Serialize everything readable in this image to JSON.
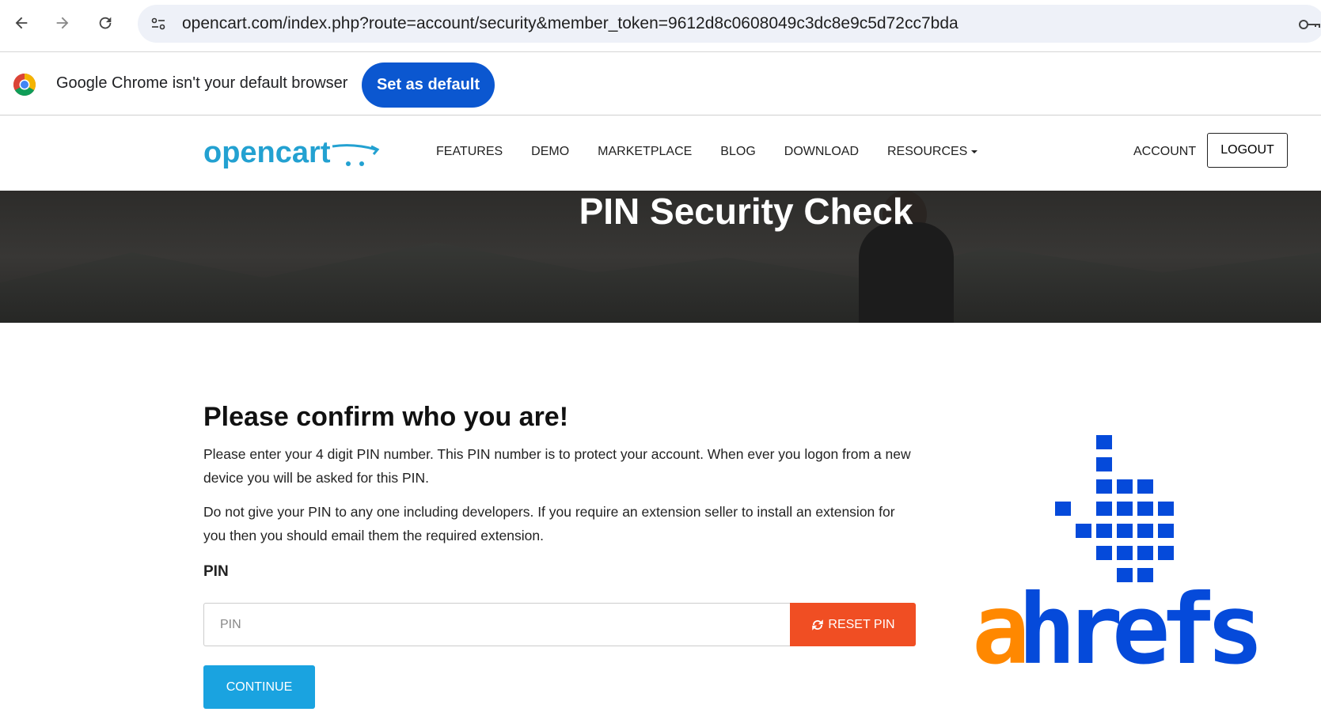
{
  "browser": {
    "url": "opencart.com/index.php?route=account/security&member_token=9612d8c0608049c3dc8e9c5d72cc7bda"
  },
  "infobar": {
    "message": "Google Chrome isn't your default browser",
    "button": "Set as default"
  },
  "header": {
    "logo_text": "opencart",
    "nav": [
      "FEATURES",
      "DEMO",
      "MARKETPLACE",
      "BLOG",
      "DOWNLOAD",
      "RESOURCES"
    ],
    "account": "ACCOUNT",
    "logout": "LOGOUT"
  },
  "hero": {
    "title": "PIN Security Check"
  },
  "main": {
    "title": "Please confirm who you are!",
    "para1": "Please enter your 4 digit PIN number. This PIN number is to protect your account. When ever you logon from a new device you will be asked for this PIN.",
    "para2": "Do not give your PIN to any one including developers. If you require an extension seller to install an extension for you then you should email them the required extension.",
    "pin_label": "PIN",
    "pin_placeholder": "PIN",
    "reset_button": "RESET PIN",
    "continue_button": "CONTINUE"
  },
  "watermark": {
    "text": "ahrefs"
  },
  "colors": {
    "chrome_blue": "#0b57d0",
    "opencart_blue": "#23a1d1",
    "reset_orange": "#f04e23",
    "continue_blue": "#1aa3e0",
    "ahrefs_orange": "#ff8800",
    "ahrefs_blue": "#054ada"
  }
}
